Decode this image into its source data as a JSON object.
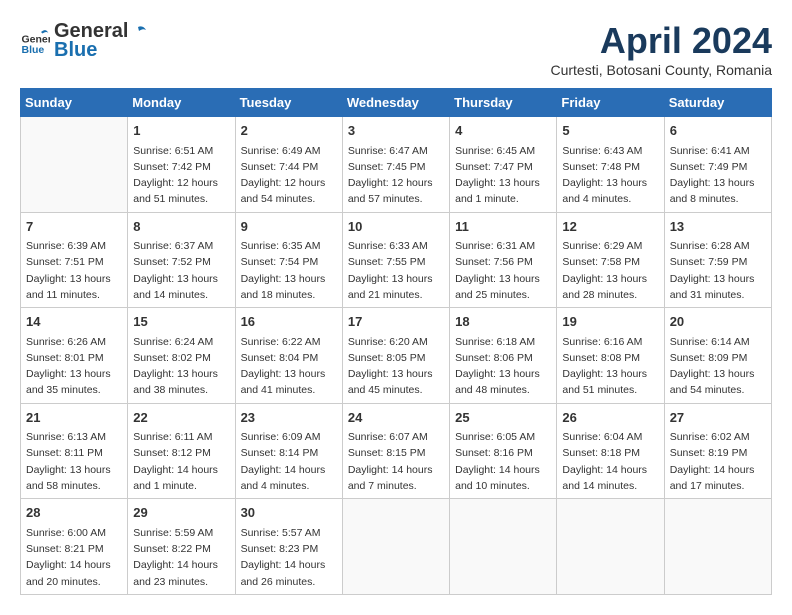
{
  "header": {
    "logo_general": "General",
    "logo_blue": "Blue",
    "title": "April 2024",
    "location": "Curtesti, Botosani County, Romania"
  },
  "weekdays": [
    "Sunday",
    "Monday",
    "Tuesday",
    "Wednesday",
    "Thursday",
    "Friday",
    "Saturday"
  ],
  "weeks": [
    [
      {
        "day": "",
        "sunrise": "",
        "sunset": "",
        "daylight": ""
      },
      {
        "day": "1",
        "sunrise": "Sunrise: 6:51 AM",
        "sunset": "Sunset: 7:42 PM",
        "daylight": "Daylight: 12 hours and 51 minutes."
      },
      {
        "day": "2",
        "sunrise": "Sunrise: 6:49 AM",
        "sunset": "Sunset: 7:44 PM",
        "daylight": "Daylight: 12 hours and 54 minutes."
      },
      {
        "day": "3",
        "sunrise": "Sunrise: 6:47 AM",
        "sunset": "Sunset: 7:45 PM",
        "daylight": "Daylight: 12 hours and 57 minutes."
      },
      {
        "day": "4",
        "sunrise": "Sunrise: 6:45 AM",
        "sunset": "Sunset: 7:47 PM",
        "daylight": "Daylight: 13 hours and 1 minute."
      },
      {
        "day": "5",
        "sunrise": "Sunrise: 6:43 AM",
        "sunset": "Sunset: 7:48 PM",
        "daylight": "Daylight: 13 hours and 4 minutes."
      },
      {
        "day": "6",
        "sunrise": "Sunrise: 6:41 AM",
        "sunset": "Sunset: 7:49 PM",
        "daylight": "Daylight: 13 hours and 8 minutes."
      }
    ],
    [
      {
        "day": "7",
        "sunrise": "Sunrise: 6:39 AM",
        "sunset": "Sunset: 7:51 PM",
        "daylight": "Daylight: 13 hours and 11 minutes."
      },
      {
        "day": "8",
        "sunrise": "Sunrise: 6:37 AM",
        "sunset": "Sunset: 7:52 PM",
        "daylight": "Daylight: 13 hours and 14 minutes."
      },
      {
        "day": "9",
        "sunrise": "Sunrise: 6:35 AM",
        "sunset": "Sunset: 7:54 PM",
        "daylight": "Daylight: 13 hours and 18 minutes."
      },
      {
        "day": "10",
        "sunrise": "Sunrise: 6:33 AM",
        "sunset": "Sunset: 7:55 PM",
        "daylight": "Daylight: 13 hours and 21 minutes."
      },
      {
        "day": "11",
        "sunrise": "Sunrise: 6:31 AM",
        "sunset": "Sunset: 7:56 PM",
        "daylight": "Daylight: 13 hours and 25 minutes."
      },
      {
        "day": "12",
        "sunrise": "Sunrise: 6:29 AM",
        "sunset": "Sunset: 7:58 PM",
        "daylight": "Daylight: 13 hours and 28 minutes."
      },
      {
        "day": "13",
        "sunrise": "Sunrise: 6:28 AM",
        "sunset": "Sunset: 7:59 PM",
        "daylight": "Daylight: 13 hours and 31 minutes."
      }
    ],
    [
      {
        "day": "14",
        "sunrise": "Sunrise: 6:26 AM",
        "sunset": "Sunset: 8:01 PM",
        "daylight": "Daylight: 13 hours and 35 minutes."
      },
      {
        "day": "15",
        "sunrise": "Sunrise: 6:24 AM",
        "sunset": "Sunset: 8:02 PM",
        "daylight": "Daylight: 13 hours and 38 minutes."
      },
      {
        "day": "16",
        "sunrise": "Sunrise: 6:22 AM",
        "sunset": "Sunset: 8:04 PM",
        "daylight": "Daylight: 13 hours and 41 minutes."
      },
      {
        "day": "17",
        "sunrise": "Sunrise: 6:20 AM",
        "sunset": "Sunset: 8:05 PM",
        "daylight": "Daylight: 13 hours and 45 minutes."
      },
      {
        "day": "18",
        "sunrise": "Sunrise: 6:18 AM",
        "sunset": "Sunset: 8:06 PM",
        "daylight": "Daylight: 13 hours and 48 minutes."
      },
      {
        "day": "19",
        "sunrise": "Sunrise: 6:16 AM",
        "sunset": "Sunset: 8:08 PM",
        "daylight": "Daylight: 13 hours and 51 minutes."
      },
      {
        "day": "20",
        "sunrise": "Sunrise: 6:14 AM",
        "sunset": "Sunset: 8:09 PM",
        "daylight": "Daylight: 13 hours and 54 minutes."
      }
    ],
    [
      {
        "day": "21",
        "sunrise": "Sunrise: 6:13 AM",
        "sunset": "Sunset: 8:11 PM",
        "daylight": "Daylight: 13 hours and 58 minutes."
      },
      {
        "day": "22",
        "sunrise": "Sunrise: 6:11 AM",
        "sunset": "Sunset: 8:12 PM",
        "daylight": "Daylight: 14 hours and 1 minute."
      },
      {
        "day": "23",
        "sunrise": "Sunrise: 6:09 AM",
        "sunset": "Sunset: 8:14 PM",
        "daylight": "Daylight: 14 hours and 4 minutes."
      },
      {
        "day": "24",
        "sunrise": "Sunrise: 6:07 AM",
        "sunset": "Sunset: 8:15 PM",
        "daylight": "Daylight: 14 hours and 7 minutes."
      },
      {
        "day": "25",
        "sunrise": "Sunrise: 6:05 AM",
        "sunset": "Sunset: 8:16 PM",
        "daylight": "Daylight: 14 hours and 10 minutes."
      },
      {
        "day": "26",
        "sunrise": "Sunrise: 6:04 AM",
        "sunset": "Sunset: 8:18 PM",
        "daylight": "Daylight: 14 hours and 14 minutes."
      },
      {
        "day": "27",
        "sunrise": "Sunrise: 6:02 AM",
        "sunset": "Sunset: 8:19 PM",
        "daylight": "Daylight: 14 hours and 17 minutes."
      }
    ],
    [
      {
        "day": "28",
        "sunrise": "Sunrise: 6:00 AM",
        "sunset": "Sunset: 8:21 PM",
        "daylight": "Daylight: 14 hours and 20 minutes."
      },
      {
        "day": "29",
        "sunrise": "Sunrise: 5:59 AM",
        "sunset": "Sunset: 8:22 PM",
        "daylight": "Daylight: 14 hours and 23 minutes."
      },
      {
        "day": "30",
        "sunrise": "Sunrise: 5:57 AM",
        "sunset": "Sunset: 8:23 PM",
        "daylight": "Daylight: 14 hours and 26 minutes."
      },
      {
        "day": "",
        "sunrise": "",
        "sunset": "",
        "daylight": ""
      },
      {
        "day": "",
        "sunrise": "",
        "sunset": "",
        "daylight": ""
      },
      {
        "day": "",
        "sunrise": "",
        "sunset": "",
        "daylight": ""
      },
      {
        "day": "",
        "sunrise": "",
        "sunset": "",
        "daylight": ""
      }
    ]
  ]
}
